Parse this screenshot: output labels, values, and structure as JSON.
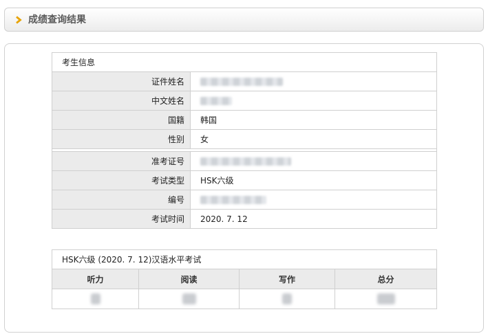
{
  "header": {
    "title": "成绩查询结果",
    "arrow_color": "#e8a300"
  },
  "candidate_info": {
    "section_title": "考生信息",
    "rows_personal": [
      {
        "label": "证件姓名",
        "value": "",
        "redacted": true
      },
      {
        "label": "中文姓名",
        "value": "",
        "redacted": true
      },
      {
        "label": "国籍",
        "value": "韩国",
        "redacted": false
      },
      {
        "label": "性别",
        "value": "女",
        "redacted": false
      }
    ],
    "rows_exam": [
      {
        "label": "准考证号",
        "value": "",
        "redacted": true
      },
      {
        "label": "考试类型",
        "value": "HSK六级",
        "redacted": false
      },
      {
        "label": "编号",
        "value": "",
        "redacted": true
      },
      {
        "label": "考试时间",
        "value": "2020. 7. 12",
        "redacted": false
      }
    ]
  },
  "scores": {
    "exam_title": "HSK六级 (2020. 7. 12)汉语水平考试",
    "columns": [
      "听力",
      "阅读",
      "写作",
      "总分"
    ]
  }
}
